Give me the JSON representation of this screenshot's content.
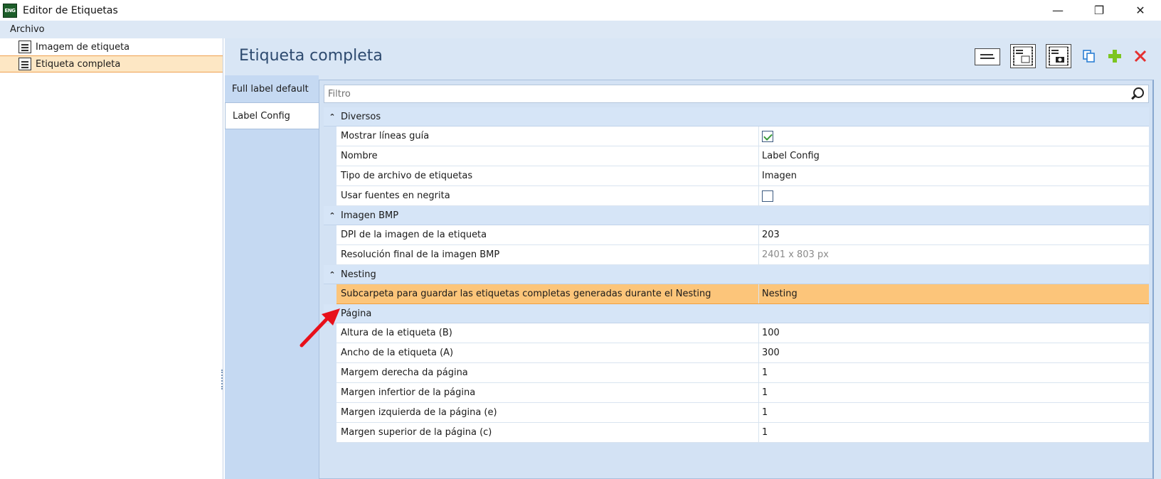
{
  "window": {
    "title": "Editor de Etiquetas",
    "app_icon_text": "ENG",
    "minimize": "—",
    "restore": "❐",
    "close": "✕"
  },
  "menu": {
    "file": "Archivo"
  },
  "tree": {
    "items": [
      {
        "label": "Imagem de etiqueta",
        "selected": false
      },
      {
        "label": "Etiqueta completa",
        "selected": true
      }
    ]
  },
  "header": {
    "title": "Etiqueta completa"
  },
  "tabs": [
    {
      "label": "Full label default",
      "active": false
    },
    {
      "label": "Label Config",
      "active": true
    }
  ],
  "filter": {
    "placeholder": "Filtro"
  },
  "categories": [
    {
      "label": "Diversos",
      "rows": [
        {
          "name": "Mostrar líneas guía",
          "type": "checkbox",
          "checked": true
        },
        {
          "name": "Nombre",
          "value": "Label Config"
        },
        {
          "name": "Tipo de archivo de etiquetas",
          "value": "Imagen"
        },
        {
          "name": "Usar fuentes en negrita",
          "type": "checkbox",
          "checked": false
        }
      ]
    },
    {
      "label": "Imagen BMP",
      "rows": [
        {
          "name": "DPI de la imagen de la etiqueta",
          "value": "203"
        },
        {
          "name": "Resolución final de la imagen BMP",
          "value": "2401 x 803 px",
          "muted": true
        }
      ]
    },
    {
      "label": "Nesting",
      "rows": [
        {
          "name": "Subcarpeta para guardar las etiquetas completas generadas durante el Nesting",
          "value": "Nesting",
          "selected": true
        }
      ]
    },
    {
      "label": "Página",
      "rows": [
        {
          "name": "Altura de la etiqueta (B)",
          "value": "100"
        },
        {
          "name": "Ancho de la etiqueta (A)",
          "value": "300"
        },
        {
          "name": "Margem derecha da página",
          "value": "1"
        },
        {
          "name": "Margen infertior de la página",
          "value": "1"
        },
        {
          "name": "Margen izquierda de la página (e)",
          "value": "1"
        },
        {
          "name": "Margen superior de la página (c)",
          "value": "1"
        }
      ]
    }
  ],
  "colors": {
    "accent": "#2d4a6f",
    "selection": "#fcc57a",
    "delete": "#e53030",
    "add": "#7cc520",
    "annotation_arrow": "#e8101a"
  }
}
